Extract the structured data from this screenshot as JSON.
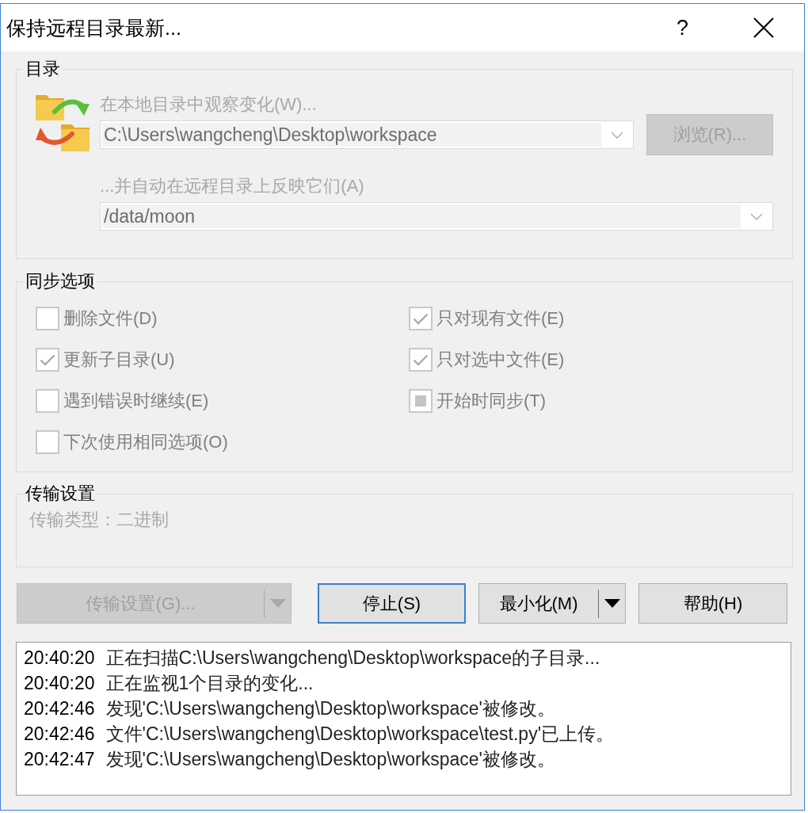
{
  "window": {
    "title": "保持远程目录最新...",
    "help_button": "?"
  },
  "directory": {
    "legend": "目录",
    "disabled": true,
    "local_label": "在本地目录中观察变化(W)...",
    "local_path": "C:\\Users\\wangcheng\\Desktop\\workspace",
    "browse_button": "浏览(R)...",
    "remote_label": "...并自动在远程目录上反映它们(A)",
    "remote_path": "/data/moon"
  },
  "sync_options": {
    "legend": "同步选项",
    "disabled": true,
    "checkboxes": [
      {
        "label": "删除文件(D)",
        "checked": false,
        "indeterminate": false
      },
      {
        "label": "只对现有文件(E)",
        "checked": true,
        "indeterminate": false
      },
      {
        "label": "更新子目录(U)",
        "checked": true,
        "indeterminate": false
      },
      {
        "label": "只对选中文件(E)",
        "checked": true,
        "indeterminate": false
      },
      {
        "label": "遇到错误时继续(E)",
        "checked": false,
        "indeterminate": false
      },
      {
        "label": "开始时同步(T)",
        "checked": false,
        "indeterminate": true
      },
      {
        "label": "下次使用相同选项(O)",
        "checked": false,
        "indeterminate": false
      }
    ]
  },
  "transfer_settings": {
    "legend": "传输设置",
    "disabled": true,
    "text": "传输类型：二进制"
  },
  "buttons": [
    {
      "label": "传输设置(G)...",
      "kind": "split",
      "disabled": true,
      "default": false
    },
    {
      "label": "停止(S)",
      "kind": "push",
      "disabled": false,
      "default": true
    },
    {
      "label": "最小化(M)",
      "kind": "split",
      "disabled": false,
      "default": false
    },
    {
      "label": "帮助(H)",
      "kind": "push",
      "disabled": false,
      "default": false
    }
  ],
  "log": [
    {
      "time": "20:40:20",
      "message": "正在扫描C:\\Users\\wangcheng\\Desktop\\workspace的子目录..."
    },
    {
      "time": "20:40:20",
      "message": "正在监视1个目录的变化..."
    },
    {
      "time": "20:42:46",
      "message": "发现'C:\\Users\\wangcheng\\Desktop\\workspace'被修改。"
    },
    {
      "time": "20:42:46",
      "message": "文件'C:\\Users\\wangcheng\\Desktop\\workspace\\test.py'已上传。"
    },
    {
      "time": "20:42:47",
      "message": "发现'C:\\Users\\wangcheng\\Desktop\\workspace'被修改。"
    }
  ]
}
